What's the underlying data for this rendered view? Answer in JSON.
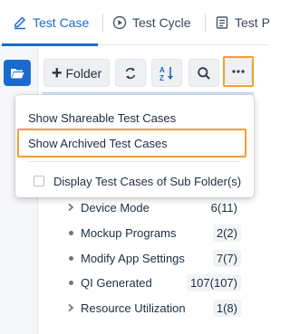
{
  "tabs": [
    {
      "label": "Test Case",
      "active": true,
      "icon": "test-case-icon"
    },
    {
      "label": "Test Cycle",
      "active": false,
      "icon": "test-cycle-icon"
    },
    {
      "label": "Test P",
      "active": false,
      "icon": "test-plan-icon"
    }
  ],
  "toolbar": {
    "folder_label": "Folder",
    "icons": [
      "plus-icon",
      "refresh-icon",
      "sort-icon",
      "search-icon",
      "more-icon"
    ]
  },
  "menu": {
    "items": [
      {
        "label": "Show Shareable Test Cases"
      },
      {
        "label": "Show Archived Test Cases",
        "highlighted": true
      }
    ],
    "checkbox_label": "Display Test Cases of Sub Folder(s)",
    "checkbox_checked": false
  },
  "tree": {
    "items": [
      {
        "label": "Device Mode",
        "count": "6(11)",
        "expandable": true
      },
      {
        "label": "Mockup Programs",
        "count": "2(2)",
        "expandable": false
      },
      {
        "label": "Modify App Settings",
        "count": "7(7)",
        "expandable": false
      },
      {
        "label": "QI Generated",
        "count": "107(107)",
        "expandable": false
      },
      {
        "label": "Resource Utilization",
        "count": "1(8)",
        "expandable": true
      }
    ]
  },
  "colors": {
    "accent": "#1b6ad0",
    "highlight_outline": "#f0a030"
  }
}
